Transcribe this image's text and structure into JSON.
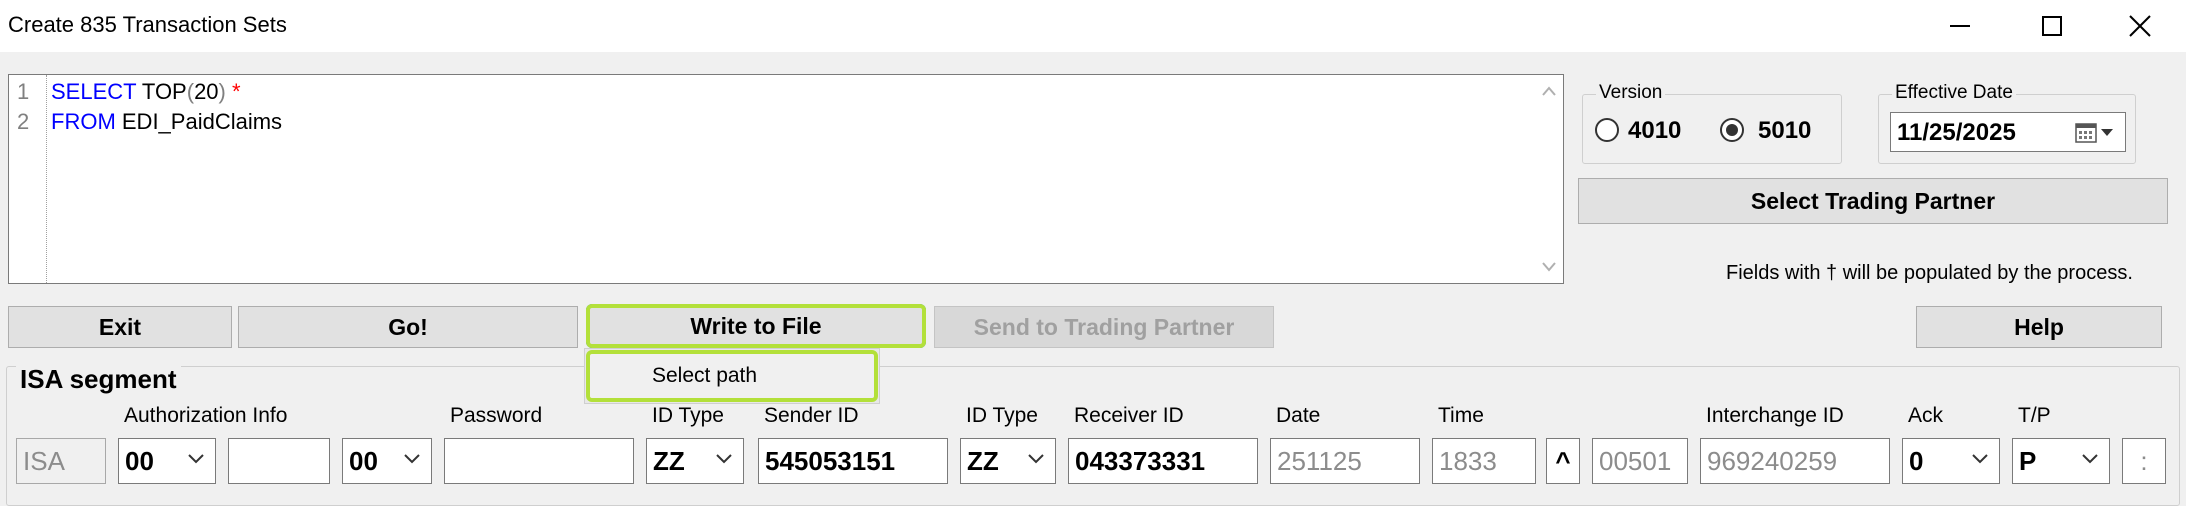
{
  "window": {
    "title": "Create 835 Transaction Sets",
    "controls": [
      "minimize",
      "maximize",
      "close"
    ]
  },
  "editor": {
    "line_numbers": [
      "1",
      "2"
    ],
    "line1": {
      "kw": "SELECT",
      "rest1": " TOP",
      "open": "(",
      "num": "20",
      "close": ")",
      "star": " *"
    },
    "line2": {
      "kw": "FROM",
      "rest": " EDI_PaidClaims"
    }
  },
  "version": {
    "legend": "Version",
    "options": [
      {
        "label": "4010",
        "selected": false
      },
      {
        "label": "5010",
        "selected": true
      }
    ]
  },
  "effective_date": {
    "legend": "Effective Date",
    "value": "11/25/2025"
  },
  "buttons": {
    "select_trading_partner": "Select Trading Partner",
    "exit": "Exit",
    "go": "Go!",
    "write_to_file": "Write to File",
    "send_to_trading_partner": "Send to Trading Partner",
    "help": "Help"
  },
  "write_menu": {
    "select_path": "Select path"
  },
  "note": "Fields with † will be populated by the process.",
  "isa": {
    "title": "ISA segment",
    "labels": {
      "authorization_info": "Authorization Info",
      "password": "Password",
      "id_type_sender": "ID Type",
      "sender_id": "Sender ID",
      "id_type_receiver": "ID Type",
      "receiver_id": "Receiver ID",
      "date": "Date",
      "time": "Time",
      "interchange_id": "Interchange ID",
      "ack": "Ack",
      "tp": "T/P"
    },
    "fields": {
      "segment": "ISA",
      "auth_qualifier": "00",
      "auth_info": "",
      "password_qualifier": "00",
      "password": "",
      "sender_id_type": "ZZ",
      "sender_id": "545053151",
      "receiver_id_type": "ZZ",
      "receiver_id": "043373331",
      "date": "251125",
      "time": "1833",
      "repetition_separator": "^",
      "version": "00501",
      "interchange_id": "969240259",
      "ack": "0",
      "tp": "P",
      "component_separator": ":"
    }
  },
  "colors": {
    "keyword": "#0000ff",
    "highlight": "#b3e03a",
    "star": "#ff0000"
  }
}
